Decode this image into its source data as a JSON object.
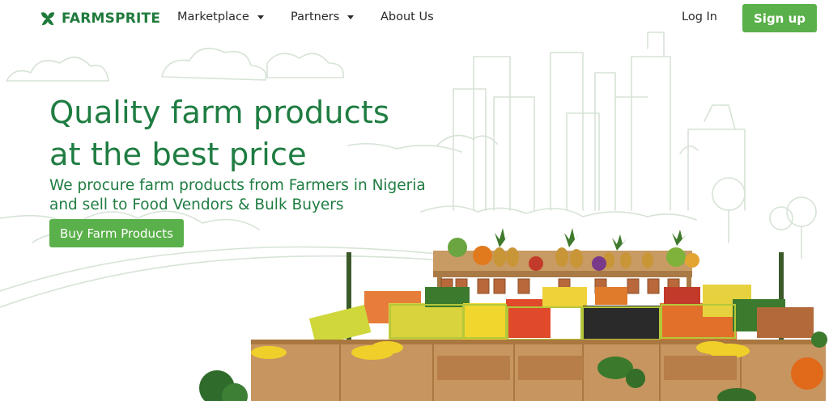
{
  "brand": {
    "name": "FARMSPRITE",
    "color": "#1f7a3c"
  },
  "nav": {
    "items": [
      {
        "label": "Marketplace",
        "has_dropdown": true
      },
      {
        "label": "Partners",
        "has_dropdown": true
      },
      {
        "label": "About Us",
        "has_dropdown": false
      }
    ],
    "login_label": "Log In",
    "signup_label": "Sign up"
  },
  "hero": {
    "title_line1": "Quality farm products",
    "title_line2": "at the best price",
    "subtitle_line1": "We procure farm products from Farmers in Nigeria",
    "subtitle_line2": "and sell to Food Vendors & Bulk Buyers",
    "cta_label": "Buy Farm Products"
  },
  "colors": {
    "accent": "#5ab04a",
    "heading": "#1f7d42",
    "line_art": "#d7e3d6"
  },
  "icons": [
    "leaf-logo-icon",
    "chevron-down-icon"
  ]
}
